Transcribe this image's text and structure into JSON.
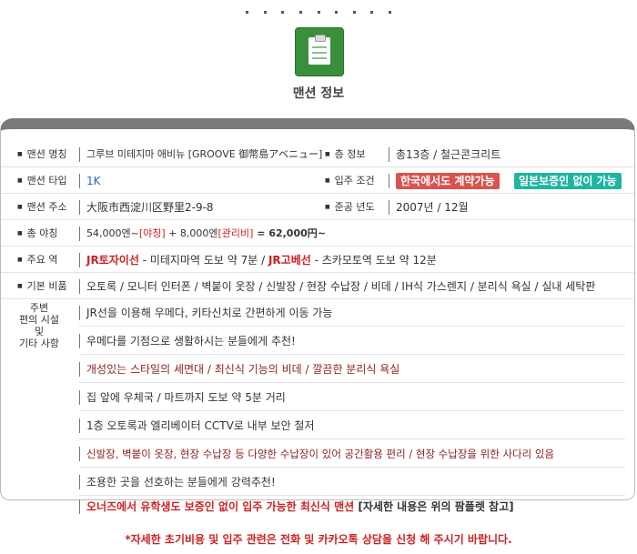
{
  "header": {
    "title": "맨션 정보"
  },
  "info": {
    "name_label": "맨션 명칭",
    "name_value": "그루브 미테지마 애비뉴 [GROOVE 御幣島アベニュー]",
    "floors_label": "층 정보",
    "floors_value": "총13층 / 철근콘크리트",
    "type_label": "맨션 타입",
    "type_value": "1K",
    "condition_label": "입주 조건",
    "badge_korea": "한국에서도 계약가능",
    "badge_guarantor": "일본보증인 없이 가능",
    "address_label": "맨션 주소",
    "address_value": "大阪市西淀川区野里2-9-8",
    "built_label": "준공 년도",
    "built_value": "2007년 / 12월",
    "rent_label": "총 야칭",
    "rent_base": "54,000엔~",
    "rent_base_tag": "[야칭]",
    "rent_plus": " + 8,000엔",
    "rent_mgmt_tag": "[관리비]",
    "rent_total": " = 62,000円~",
    "station_label": "주요 역",
    "station_line1": "JR토자이선",
    "station_text1": " - 미테지마역 도보 약 7분 / ",
    "station_line2": "JR고베선",
    "station_text2": " - 츠카모토역 도보 약 12분",
    "equip_label": "기본 비품",
    "equip_value": "오토록 / 모니터 인터폰 / 벽붙이 옷장 / 신발장 / 현장 수납장 / 비데 / IH식 가스렌지 / 분리식 욕실 / 실내 세탁판"
  },
  "around": {
    "label_line1": "주변",
    "label_line2": "편의 시설",
    "label_line3": "및",
    "label_line4": "기타 사항",
    "items": [
      "JR선을 이용해 우메다, 키타신치로 간편하게 이동 가능",
      "우메다를 기점으로 생활하시는 분들에게 추천!",
      "개성있는 스타일의 세면대 / 최신식 기능의 비데 / 깔끔한 분리식 욕실",
      "집 앞에 우체국 / 마트까지 도보 약 5분 거리",
      "1층 오토록과 엘리베이터 CCTV로 내부 보안 철저",
      "신발장, 벽붙이 옷장, 현장 수납장 등 다양한 수납장이 있어 공간활용 편리 / 현장 수납장을 위한 사다리 있음",
      "조용한 곳을 선호하는 분들에게 강력추천!"
    ],
    "last_red": "오너즈에서 유학생도 보증인 없이 입주 가능한 최신식 맨션",
    "last_black": " [자세한 내용은 위의 팜플렛 참고]"
  },
  "footer": {
    "note": "*자세한 초기비용 및 입주 관련은 전화 및 카카오톡 상담을 신청 해 주시기 바랍니다."
  },
  "colors": {
    "badge_korea": "#d9534f",
    "badge_guarantor": "#1fb5a0",
    "accent_red": "#cc2222",
    "icon_green": "#3a8f3a"
  },
  "icons": {
    "hero": "clipboard-icon"
  }
}
